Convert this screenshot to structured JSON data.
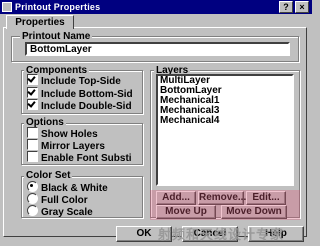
{
  "window": {
    "title": "Printout Properties",
    "help_glyph": "?",
    "close_glyph": "×"
  },
  "tabs": [
    {
      "label": "Properties"
    }
  ],
  "printout_name": {
    "label": "Printout Name",
    "value": "BottomLayer"
  },
  "components": {
    "label": "Components",
    "items": [
      {
        "label": "Include Top-Side",
        "checked": true
      },
      {
        "label": "Include Bottom-Sid",
        "checked": true
      },
      {
        "label": "Include Double-Sid",
        "checked": true
      }
    ]
  },
  "options": {
    "label": "Options",
    "items": [
      {
        "label": "Show Holes",
        "checked": false
      },
      {
        "label": "Mirror Layers",
        "checked": false
      },
      {
        "label": "Enable Font Substi",
        "checked": false
      }
    ]
  },
  "color_set": {
    "label": "Color Set",
    "items": [
      {
        "label": "Black & White",
        "selected": true
      },
      {
        "label": "Full Color",
        "selected": false
      },
      {
        "label": "Gray Scale",
        "selected": false
      }
    ]
  },
  "layers": {
    "label": "Layers",
    "items": [
      "MultiLayer",
      "BottomLayer",
      "Mechanical1",
      "Mechanical3",
      "Mechanical4"
    ]
  },
  "layer_buttons": {
    "add": "Add...",
    "remove": "Remove...",
    "edit": "Edit...",
    "move_up": "Move Up",
    "move_down": "Move Down"
  },
  "dialog_buttons": {
    "ok": "OK",
    "cancel": "Cancel",
    "help": "Help"
  },
  "watermark": "射频和天线设计专家"
}
